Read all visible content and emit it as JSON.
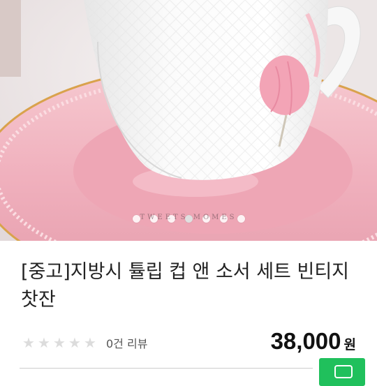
{
  "product_image": {
    "watermark": "TWEETS MOMES",
    "carousel_dot_count": 7,
    "carousel_active_index": 3
  },
  "product": {
    "title": "[중고]지방시 튤립 컵 앤 소서 세트 빈티지 찻잔",
    "rating_stars": 0,
    "rating_max": 5,
    "review_label": "0건 리뷰",
    "price_value": "38,000",
    "price_unit": "원"
  },
  "chat_button": {
    "icon": "chat-icon",
    "color": "#20c05c"
  },
  "colors": {
    "saucer_pink": "#f2b8c2",
    "tulip_pink": "#f3a4b6",
    "star_empty": "#dcdcdc"
  }
}
